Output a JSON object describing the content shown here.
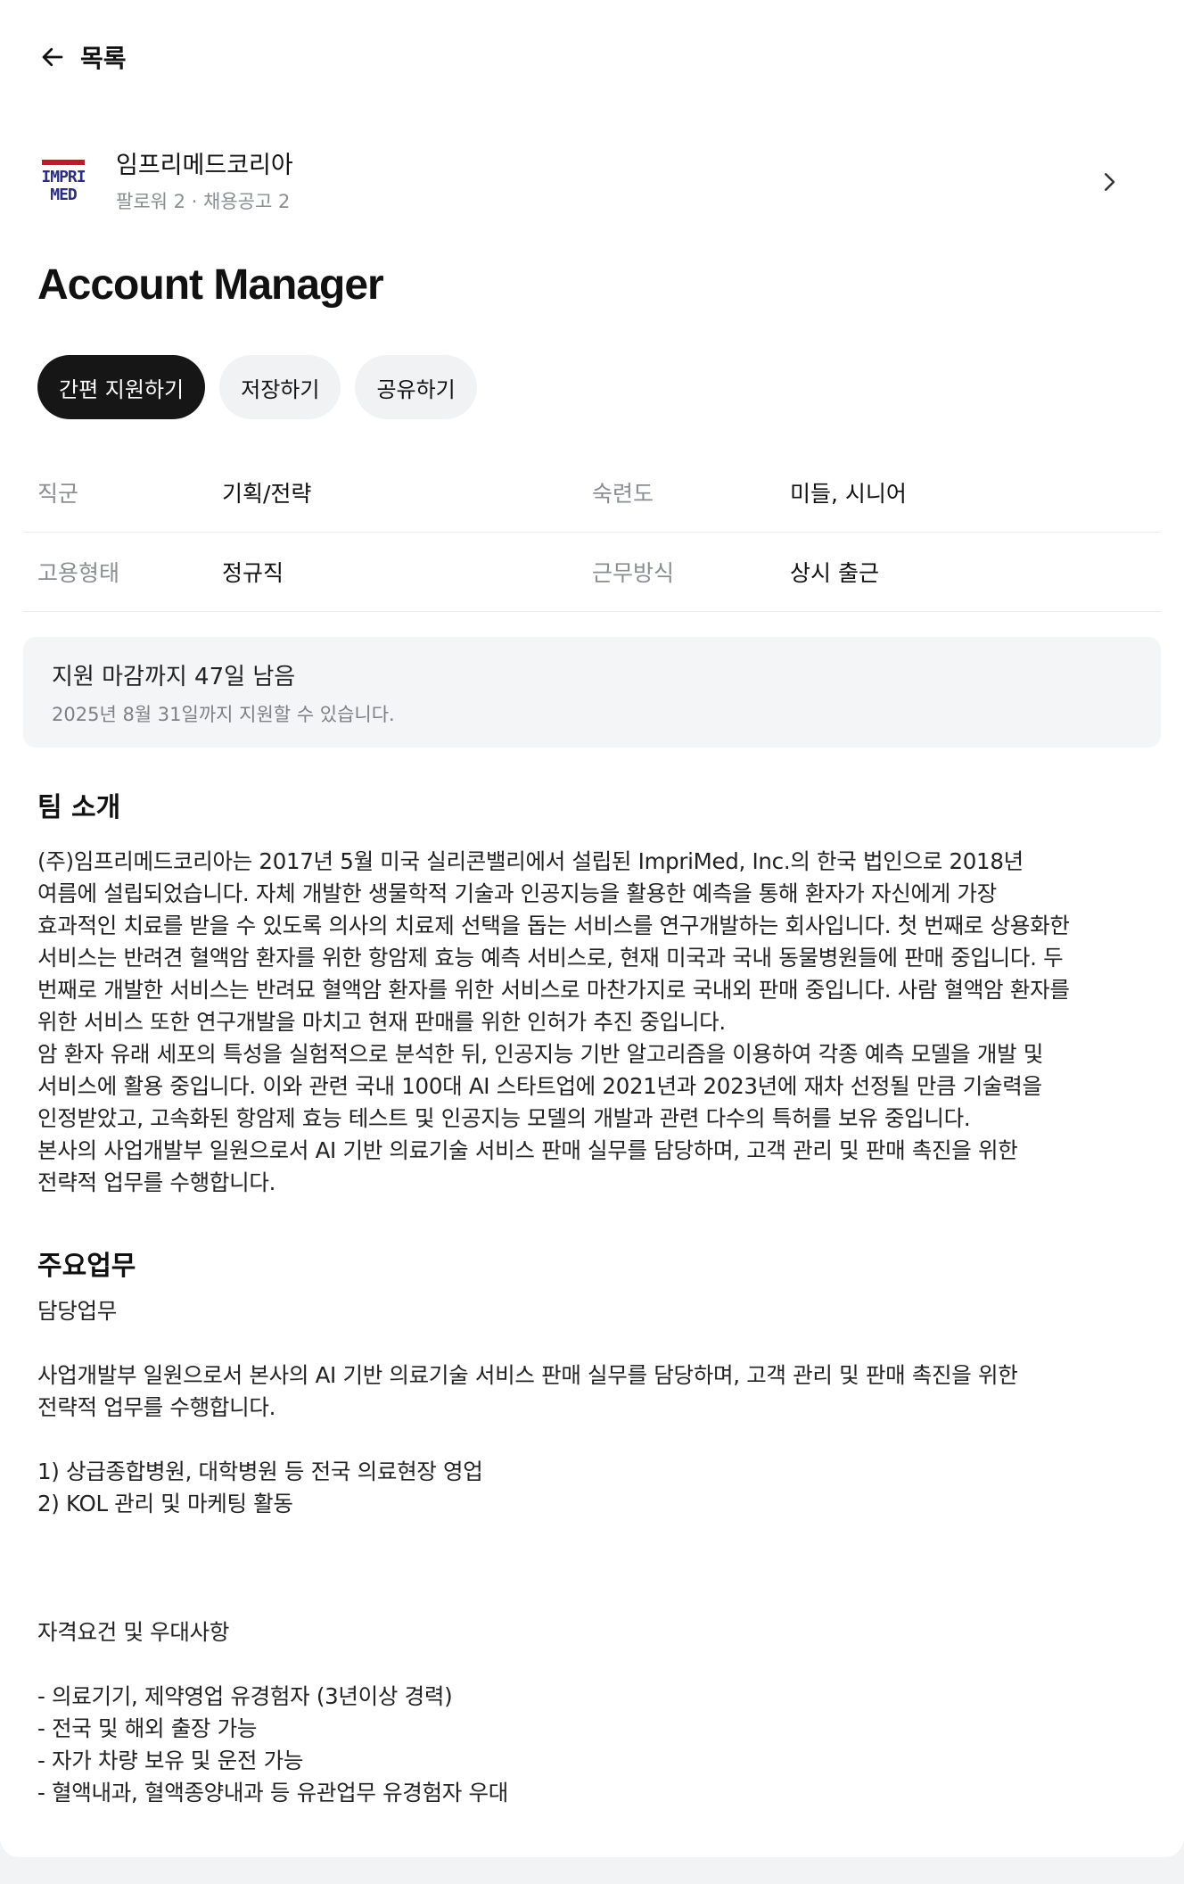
{
  "nav": {
    "back_label": "목록"
  },
  "company": {
    "logo_text": "IMPRI\nMED",
    "name": "임프리메드코리아",
    "followers": "팔로워 2",
    "separator": " · ",
    "job_postings": "채용공고 2"
  },
  "job": {
    "title": "Account Manager"
  },
  "actions": {
    "apply_label": "간편 지원하기",
    "save_label": "저장하기",
    "share_label": "공유하기"
  },
  "info": {
    "rows": [
      {
        "label1": "직군",
        "value1": "기획/전략",
        "label2": "숙련도",
        "value2": "미들, 시니어"
      },
      {
        "label1": "고용형태",
        "value1": "정규직",
        "label2": "근무방식",
        "value2": "상시 출근"
      }
    ]
  },
  "deadline": {
    "title": "지원 마감까지 47일 남음",
    "subtitle": "2025년 8월 31일까지 지원할 수 있습니다."
  },
  "team": {
    "heading": "팀 소개",
    "body": "(주)임프리메드코리아는 2017년 5월 미국 실리콘밸리에서 설립된 ImpriMed, Inc.의 한국 법인으로 2018년\n여름에 설립되었습니다. 자체 개발한 생물학적 기술과 인공지능을 활용한 예측을 통해 환자가 자신에게 가장\n효과적인 치료를 받을 수 있도록 의사의 치료제 선택을 돕는 서비스를 연구개발하는 회사입니다. 첫 번째로 상용화한\n서비스는 반려견 혈액암 환자를 위한 항암제 효능 예측 서비스로, 현재 미국과 국내 동물병원들에 판매 중입니다. 두\n번째로 개발한 서비스는 반려묘 혈액암 환자를 위한 서비스로 마찬가지로 국내외 판매 중입니다. 사람 혈액암 환자를\n위한 서비스 또한 연구개발을 마치고 현재 판매를 위한 인허가 추진 중입니다.\n암 환자 유래 세포의 특성을 실험적으로 분석한 뒤, 인공지능 기반 알고리즘을 이용하여 각종 예측 모델을 개발 및\n서비스에 활용 중입니다. 이와 관련 국내 100대 AI 스타트업에 2021년과 2023년에 재차 선정될 만큼 기술력을\n인정받았고, 고속화된 항암제 효능 테스트 및 인공지능 모델의 개발과 관련 다수의 특허를 보유 중입니다.\n본사의 사업개발부 일원으로서 AI 기반 의료기술 서비스 판매 실무를 담당하며, 고객 관리 및 판매 촉진을 위한\n전략적 업무를 수행합니다."
  },
  "duties": {
    "heading": "주요업무",
    "body": "담당업무\n\n사업개발부 일원으로서 본사의 AI 기반 의료기술 서비스 판매 실무를 담당하며, 고객 관리 및 판매 촉진을 위한\n전략적 업무를 수행합니다.\n\n1) 상급종합병원, 대학병원 등 전국 의료현장 영업\n2) KOL 관리 및 마케팅 활동\n\n\n\n자격요건 및 우대사항\n\n- 의료기기, 제약영업 유경험자 (3년이상 경력)\n- 전국 및 해외 출장 가능\n- 자가 차량 보유 및 운전 가능\n- 혈액내과, 혈액종양내과 등 유관업무 유경험자 우대"
  },
  "colors": {
    "primary_button": "#161616",
    "secondary_button": "#f1f2f4",
    "logo_red": "#b51f2b",
    "logo_navy": "#2b2f7e"
  },
  "icons": {
    "back": "arrow-left-icon",
    "company_chevron": "chevron-right-icon"
  }
}
